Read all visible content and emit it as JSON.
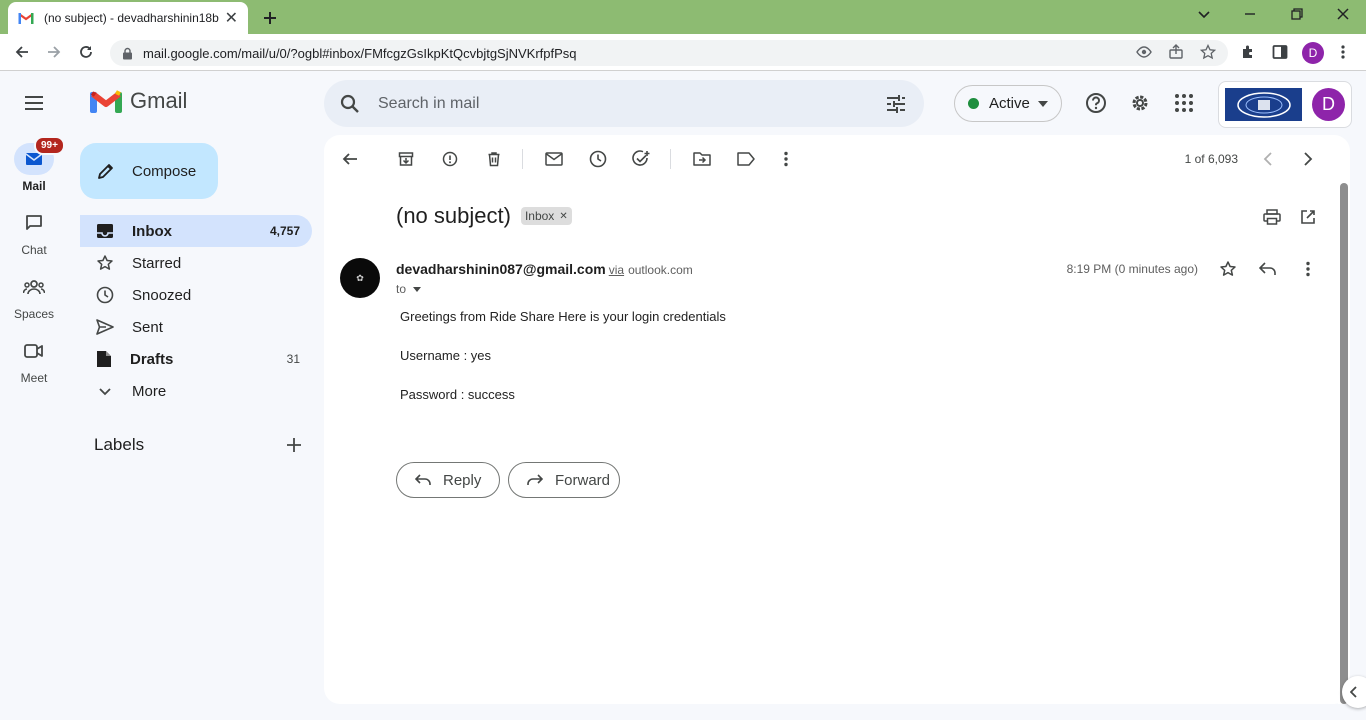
{
  "browser": {
    "tab_title": "(no subject) - devadharshinin18b",
    "url": "mail.google.com/mail/u/0/?ogbl#inbox/FMfcgzGsIkpKtQcvbjtgSjNVKrfpfPsq",
    "profile_initial": "D"
  },
  "gmail": {
    "logo_text": "Gmail",
    "search_placeholder": "Search in mail",
    "status_label": "Active",
    "account_initial": "D"
  },
  "rail": {
    "mail_label": "Mail",
    "mail_badge": "99+",
    "chat_label": "Chat",
    "spaces_label": "Spaces",
    "meet_label": "Meet"
  },
  "compose_label": "Compose",
  "nav": {
    "inbox": {
      "label": "Inbox",
      "count": "4,757"
    },
    "starred": {
      "label": "Starred"
    },
    "snoozed": {
      "label": "Snoozed"
    },
    "sent": {
      "label": "Sent"
    },
    "drafts": {
      "label": "Drafts",
      "count": "31"
    },
    "more": {
      "label": "More"
    }
  },
  "labels_heading": "Labels",
  "toolbar": {
    "pagination": "1 of 6,093"
  },
  "email": {
    "subject": "(no subject)",
    "label_chip": "Inbox",
    "sender": "devadharshinin087@gmail.com",
    "via_word": "via",
    "via_domain": "outlook.com",
    "to_label": "to",
    "time": "8:19 PM (0 minutes ago)",
    "body_lines": [
      "Greetings from Ride Share Here is your login credentials",
      "Username : yes",
      "Password : success"
    ],
    "reply_label": "Reply",
    "forward_label": "Forward"
  },
  "colors": {
    "chrome_tab_bar": "#8dbb72",
    "nav_selected": "#d3e3fd",
    "compose_bg": "#c2e7ff",
    "status_dot": "#1e8e3e",
    "avatar_purple": "#8e24aa",
    "badge_red": "#b3261e"
  }
}
